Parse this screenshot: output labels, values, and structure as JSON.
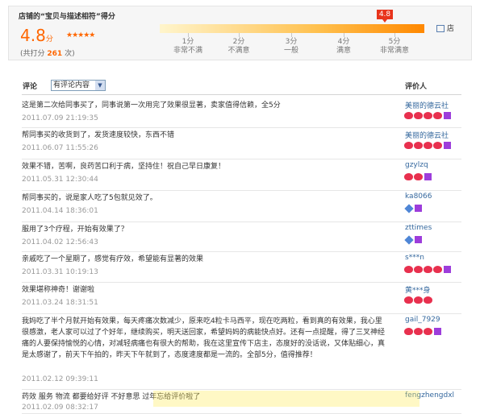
{
  "rating": {
    "title": "店铺的“宝贝与描述相符”得分",
    "score": "4.8",
    "score_unit": "分",
    "stars": "★★★★★",
    "count_prefix": "(共打分",
    "count": "261",
    "count_suffix": "次)",
    "marker": "4.8",
    "score_fraction": 0.96,
    "scale": [
      {
        "num": "1分",
        "label": "非常不满"
      },
      {
        "num": "2分",
        "label": "不满意"
      },
      {
        "num": "3分",
        "label": "一般"
      },
      {
        "num": "4分",
        "label": "满意"
      },
      {
        "num": "5分",
        "label": "非常满意"
      }
    ],
    "shop_link": "店"
  },
  "table": {
    "comment_header": "评论",
    "filter_value": "有评论内容",
    "rater_header": "评价人"
  },
  "comments": [
    {
      "text": "这是第二次给同事买了，同事说第一次用完了效果很显著，卖家值得信赖，全5分",
      "date": "2011.07.09 21:19:35",
      "user": "美丽的德云社",
      "badges": [
        "heart",
        "heart",
        "heart",
        "heart",
        "vip"
      ]
    },
    {
      "text": "帮同事买的收货到了，发货速度较快，东西不错",
      "date": "2011.06.07 11:55:26",
      "user": "美丽的德云社",
      "badges": [
        "heart",
        "heart",
        "heart",
        "heart",
        "vip"
      ]
    },
    {
      "text": "效果不错，苦啊，良药苦口利于病，坚持住！祝自己早日康复！",
      "date": "2011.05.31 12:30:44",
      "user": "gzylzq",
      "badges": [
        "heart",
        "heart",
        "vip"
      ]
    },
    {
      "text": "帮同事买的，说是家人吃了5包就见效了。",
      "date": "2011.04.14 18:36:01",
      "user": "ka8066",
      "badges": [
        "diamond",
        "vip"
      ]
    },
    {
      "text": "服用了3个疗程，开始有效果了？",
      "date": "2011.04.02 12:56:43",
      "user": "zttimes",
      "badges": [
        "diamond",
        "vip"
      ]
    },
    {
      "text": "亲戚吃了一个星期了，感觉有疗效，希望能有显著的效果",
      "date": "2011.03.31 10:19:13",
      "user": "s***n",
      "badges": [
        "heart",
        "heart",
        "heart",
        "heart",
        "vip"
      ]
    },
    {
      "text": "效果堪称神奇！谢谢啦",
      "date": "2011.03.24 18:31:51",
      "user": "黄***身",
      "badges": [
        "heart",
        "heart",
        "heart"
      ]
    },
    {
      "text": "我妈吃了半个月就开始有效果，每天疼痛次数减少，原来吃4粒卡马西平，现在吃两粒，看到真的有效果，我心里很感激，老人家可以过了个好年，继续购买，明天送回家，希望妈妈的病能快点好。还有一点提醒，得了三叉神经痛的人要保持愉悦的心情，对减轻病痛也有很大的帮助，我在这里宣传下店主，态度好的没话说，又体贴细心，真是太感谢了，前天下午拍的，昨天下午就到了，态度速度都是一流的。全部5分，值得推荐！",
      "date": "2011.02.12 09:39:11",
      "user": "gail_7929",
      "badges": [
        "heart",
        "heart",
        "heart",
        "vip"
      ]
    },
    {
      "text": "药效 服务 物流 都要给好评 不好意思 过年忘给评价啦了",
      "date": "2011.02.09 08:32:17",
      "user": "fengzhengdxl",
      "badges": []
    }
  ]
}
